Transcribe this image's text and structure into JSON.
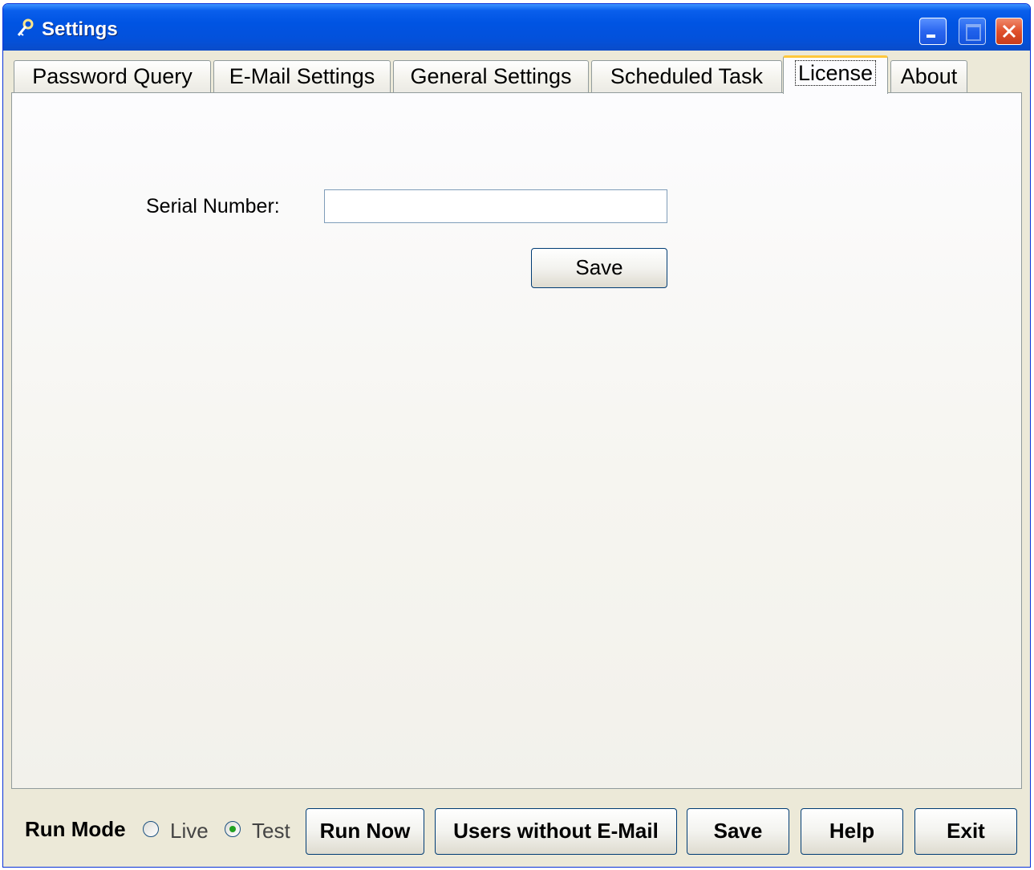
{
  "window": {
    "title": "Settings"
  },
  "tabs": [
    {
      "label": "Password Query"
    },
    {
      "label": "E-Mail Settings"
    },
    {
      "label": "General Settings"
    },
    {
      "label": "Scheduled Task"
    },
    {
      "label": "License",
      "active": true
    },
    {
      "label": "About"
    }
  ],
  "license": {
    "serial_label": "Serial Number:",
    "serial_value": "",
    "save_label": "Save"
  },
  "footer": {
    "run_mode_label": "Run Mode",
    "live_label": "Live",
    "test_label": "Test",
    "selected_mode": "Test",
    "run_now_label": "Run Now",
    "users_without_email_label": "Users without E-Mail",
    "save_label": "Save",
    "help_label": "Help",
    "exit_label": "Exit"
  },
  "icons": {
    "app": "keys-icon",
    "minimize": "minimize-icon",
    "maximize": "maximize-icon",
    "close": "close-icon"
  }
}
